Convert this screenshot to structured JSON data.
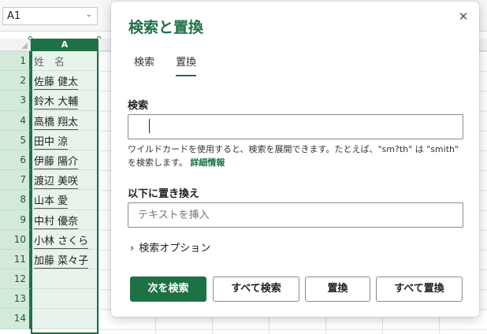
{
  "spreadsheet": {
    "name_box": "A1",
    "column_header": "A",
    "rows": [
      {
        "num": "1",
        "value": "姓　名"
      },
      {
        "num": "2",
        "value": "佐藤 健太"
      },
      {
        "num": "3",
        "value": "鈴木 大輔"
      },
      {
        "num": "4",
        "value": "高橋 翔太"
      },
      {
        "num": "5",
        "value": "田中 涼"
      },
      {
        "num": "6",
        "value": "伊藤 陽介"
      },
      {
        "num": "7",
        "value": "渡辺 美咲"
      },
      {
        "num": "8",
        "value": "山本 愛"
      },
      {
        "num": "9",
        "value": "中村 優奈"
      },
      {
        "num": "10",
        "value": "小林 さくら"
      },
      {
        "num": "11",
        "value": "加藤 菜々子"
      },
      {
        "num": "12",
        "value": ""
      },
      {
        "num": "13",
        "value": ""
      },
      {
        "num": "14",
        "value": ""
      }
    ]
  },
  "dialog": {
    "title": "検索と置換",
    "close_icon": "close-icon",
    "tabs": [
      {
        "label": "検索",
        "active": false
      },
      {
        "label": "置換",
        "active": true
      }
    ],
    "find_label": "検索",
    "find_value": "",
    "help_text": "ワイルドカードを使用すると、検索を展開できます。たとえば、\"sm?th\" は \"smith\" を検索します。",
    "help_link": "詳細情報",
    "replace_label": "以下に置き換え",
    "replace_placeholder": "テキストを挿入",
    "options_label": "検索オプション",
    "buttons": {
      "find_next": "次を検索",
      "find_all": "すべて検索",
      "replace": "置換",
      "replace_all": "すべて置換"
    }
  },
  "colors": {
    "accent": "#1e7145",
    "selected_header": "#d3eadb"
  }
}
